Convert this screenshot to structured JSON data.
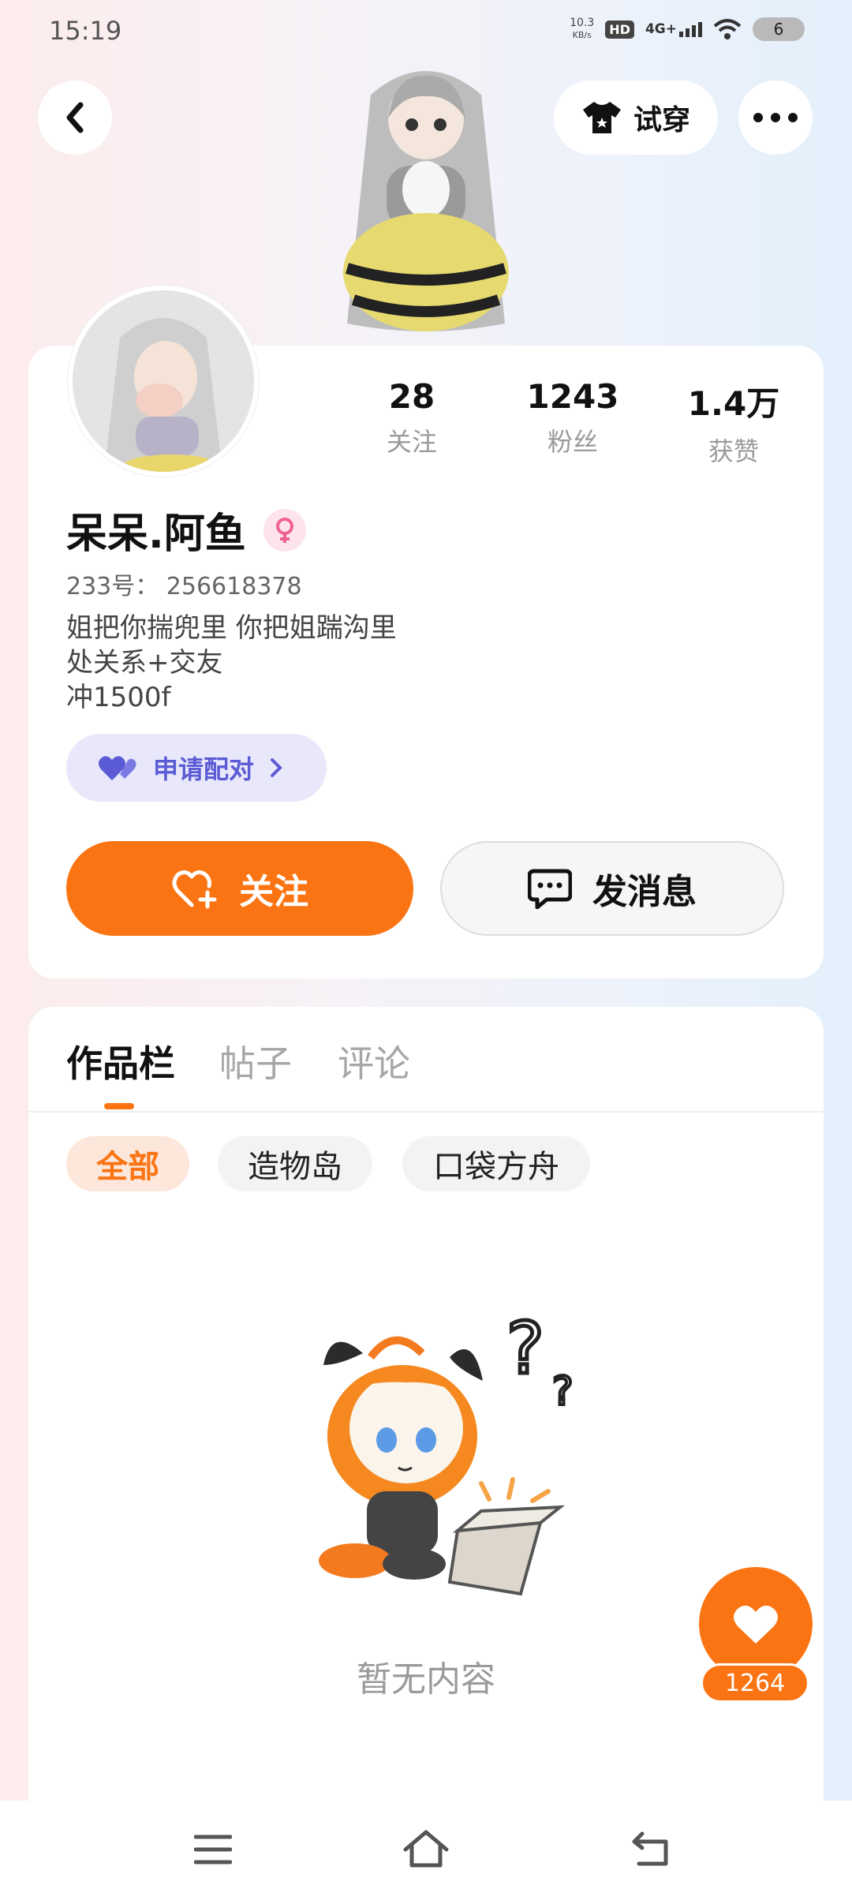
{
  "status_bar": {
    "time": "15:19",
    "net_speed_value": "10.3",
    "net_speed_unit": "KB/s",
    "hd": "HD",
    "network": "4G+",
    "battery": "6"
  },
  "top_bar": {
    "back_icon": "chevron-left-icon",
    "tryon_label": "试穿",
    "more_icon": "more-dots-icon"
  },
  "profile": {
    "stats": [
      {
        "value": "28",
        "label": "关注"
      },
      {
        "value": "1243",
        "label": "粉丝"
      },
      {
        "value": "1.4万",
        "label": "获赞"
      }
    ],
    "nickname": "呆呆.阿鱼",
    "gender_icon": "female-icon",
    "uid": "233号： 256618378",
    "bio_lines": [
      "姐把你揣兜里 你把姐踹沟里",
      "处关系+交友",
      "冲1500f"
    ],
    "pair_label": "申请配对",
    "follow_label": "关注",
    "message_label": "发消息"
  },
  "works": {
    "tabs": [
      "作品栏",
      "帖子",
      "评论"
    ],
    "chips": [
      "全部",
      "造物岛",
      "口袋方舟"
    ],
    "empty_text": "暂无内容"
  },
  "like_fab": {
    "count": "1264"
  },
  "colors": {
    "accent": "#fb7413",
    "pair": "#5b5bd6"
  }
}
